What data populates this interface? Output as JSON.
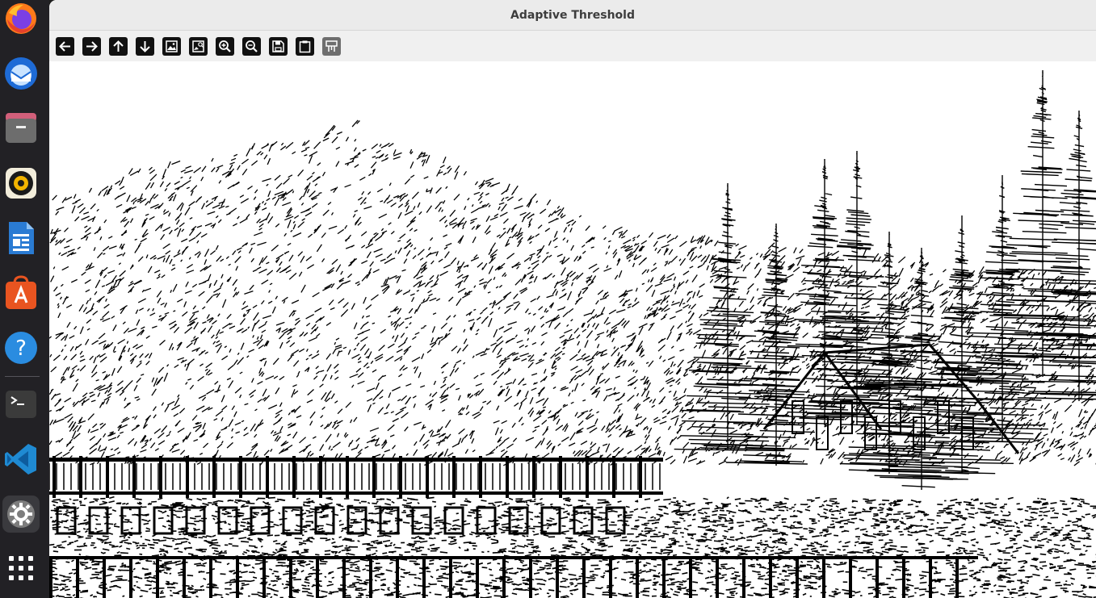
{
  "window": {
    "title": "Adaptive Threshold"
  },
  "dock": {
    "items": [
      {
        "name": "firefox",
        "icon": "firefox-icon"
      },
      {
        "name": "thunderbird",
        "icon": "thunderbird-icon"
      },
      {
        "name": "files",
        "icon": "files-icon"
      },
      {
        "name": "rhythmbox",
        "icon": "rhythmbox-icon"
      },
      {
        "name": "writer",
        "icon": "libreoffice-writer-icon"
      },
      {
        "name": "app-center",
        "icon": "app-center-icon"
      },
      {
        "name": "help",
        "icon": "help-icon"
      },
      {
        "name": "terminal",
        "icon": "terminal-icon"
      },
      {
        "name": "vscode",
        "icon": "vscode-icon"
      },
      {
        "name": "settings",
        "icon": "settings-icon"
      },
      {
        "name": "show-apps",
        "icon": "grid-icon"
      }
    ]
  },
  "toolbar": {
    "buttons": [
      {
        "name": "pan-left-button",
        "icon": "arrow-left-icon"
      },
      {
        "name": "pan-right-button",
        "icon": "arrow-right-icon"
      },
      {
        "name": "pan-up-button",
        "icon": "arrow-up-icon"
      },
      {
        "name": "pan-down-button",
        "icon": "arrow-down-icon"
      },
      {
        "name": "zoom-to-image-button",
        "icon": "image-icon"
      },
      {
        "name": "zoom-to-window-button",
        "icon": "image-zoom-icon"
      },
      {
        "name": "zoom-in-button",
        "icon": "zoom-in-icon"
      },
      {
        "name": "zoom-out-button",
        "icon": "zoom-out-icon"
      },
      {
        "name": "save-button",
        "icon": "save-icon"
      },
      {
        "name": "copy-button",
        "icon": "clipboard-icon"
      },
      {
        "name": "properties-button",
        "icon": "properties-icon"
      }
    ]
  },
  "image": {
    "description_icon": "thresholded-landscape-image",
    "colors": {
      "foreground": "#000000",
      "background": "#ffffff"
    }
  }
}
